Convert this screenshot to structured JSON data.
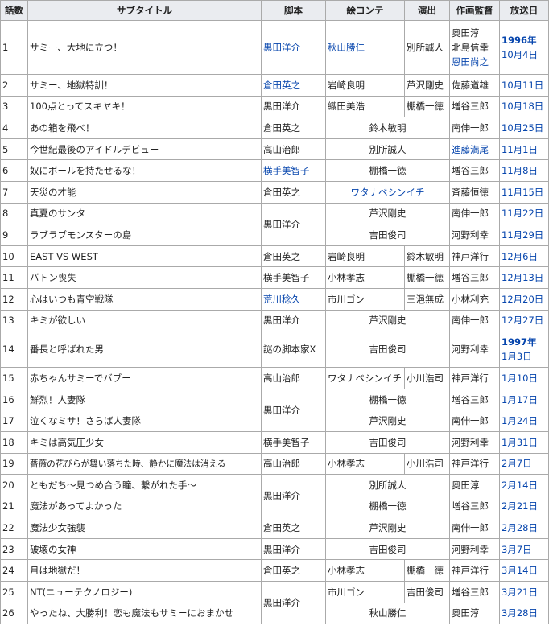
{
  "headers": {
    "num": "話数",
    "subtitle": "サブタイトル",
    "script": "脚本",
    "storyboard": "絵コンテ",
    "director": "演出",
    "animation": "作画監督",
    "airdate": "放送日"
  },
  "episodes": [
    {
      "num": "1",
      "subtitle": "サミー、大地に立つ！",
      "script": "黒田洋介",
      "storyboard": "秋山勝仁",
      "director": "別所誠人",
      "animation": [
        "奥田淳",
        "北島信幸",
        "恩田尚之"
      ],
      "year": "1996年",
      "date": "10月4日"
    },
    {
      "num": "2",
      "subtitle": "サミー、地獄特訓！",
      "script": "倉田英之",
      "storyboard": "岩崎良明",
      "director": "芦沢剛史",
      "animation": [
        "佐藤道雄"
      ],
      "date": "10月11日"
    },
    {
      "num": "3",
      "subtitle": "100点とってスキヤキ！",
      "script": "黒田洋介",
      "storyboard": "織田美浩",
      "director": "棚橋一徳",
      "animation": [
        "増谷三郎"
      ],
      "date": "10月18日"
    },
    {
      "num": "4",
      "subtitle": "あの箱を飛べ！",
      "script": "倉田英之",
      "storyboard": "鈴木敏明",
      "animation": [
        "南伸一郎"
      ],
      "date": "10月25日"
    },
    {
      "num": "5",
      "subtitle": "今世紀最後のアイドルデビュー",
      "script": "高山治郎",
      "storyboard": "別所誠人",
      "animation": [
        "進藤満尾"
      ],
      "date": "11月1日"
    },
    {
      "num": "6",
      "subtitle": "奴にボールを持たせるな！",
      "script": "横手美智子",
      "storyboard": "棚橋一徳",
      "animation": [
        "増谷三郎"
      ],
      "date": "11月8日"
    },
    {
      "num": "7",
      "subtitle": "天災の才能",
      "script": "倉田英之",
      "storyboard": "ワタナベシンイチ",
      "animation": [
        "斉藤恒徳"
      ],
      "date": "11月15日"
    },
    {
      "num": "8",
      "subtitle": "真夏のサンタ",
      "script": "黒田洋介",
      "storyboard": "芦沢剛史",
      "animation": [
        "南伸一郎"
      ],
      "date": "11月22日"
    },
    {
      "num": "9",
      "subtitle": "ラブラブモンスターの島",
      "storyboard": "吉田俊司",
      "animation": [
        "河野利幸"
      ],
      "date": "11月29日"
    },
    {
      "num": "10",
      "subtitle": "EAST VS WEST",
      "script": "倉田英之",
      "storyboard": "岩崎良明",
      "director": "鈴木敏明",
      "animation": [
        "神戸洋行"
      ],
      "date": "12月6日"
    },
    {
      "num": "11",
      "subtitle": "バトン喪失",
      "script": "横手美智子",
      "storyboard": "小林孝志",
      "director": "棚橋一徳",
      "animation": [
        "増谷三郎"
      ],
      "date": "12月13日"
    },
    {
      "num": "12",
      "subtitle": "心はいつも青空戦隊",
      "script": "荒川稔久",
      "storyboard": "市川ゴン",
      "director": "三浥無成",
      "animation": [
        "小林利充"
      ],
      "date": "12月20日"
    },
    {
      "num": "13",
      "subtitle": "キミが欲しい",
      "script": "黒田洋介",
      "storyboard": "芦沢剛史",
      "animation": [
        "南伸一郎"
      ],
      "date": "12月27日"
    },
    {
      "num": "14",
      "subtitle": "番長と呼ばれた男",
      "script": "謎の脚本家X",
      "storyboard": "吉田俊司",
      "animation": [
        "河野利幸"
      ],
      "year": "1997年",
      "date": "1月3日"
    },
    {
      "num": "15",
      "subtitle": "赤ちゃんサミーでバブー",
      "script": "高山治郎",
      "storyboard": "ワタナベシンイチ",
      "director": "小川浩司",
      "animation": [
        "神戸洋行"
      ],
      "date": "1月10日"
    },
    {
      "num": "16",
      "subtitle": "鮮烈！人妻隊",
      "script": "黒田洋介",
      "storyboard": "棚橋一徳",
      "animation": [
        "増谷三郎"
      ],
      "date": "1月17日"
    },
    {
      "num": "17",
      "subtitle": "泣くなミサ！さらば人妻隊",
      "storyboard": "芦沢剛史",
      "animation": [
        "南伸一郎"
      ],
      "date": "1月24日"
    },
    {
      "num": "18",
      "subtitle": "キミは高気圧少女",
      "script": "横手美智子",
      "storyboard": "吉田俊司",
      "animation": [
        "河野利幸"
      ],
      "date": "1月31日"
    },
    {
      "num": "19",
      "subtitle": "薔薇の花びらが舞い落ちた時、静かに魔法は消える",
      "script": "高山治郎",
      "storyboard": "小林孝志",
      "director": "小川浩司",
      "animation": [
        "神戸洋行"
      ],
      "date": "2月7日"
    },
    {
      "num": "20",
      "subtitle": "ともだち〜見つめ合う瞳、繋がれた手〜",
      "script": "黒田洋介",
      "storyboard": "別所誠人",
      "animation": [
        "奥田淳"
      ],
      "date": "2月14日"
    },
    {
      "num": "21",
      "subtitle": "魔法があってよかった",
      "storyboard": "棚橋一徳",
      "animation": [
        "増谷三郎"
      ],
      "date": "2月21日"
    },
    {
      "num": "22",
      "subtitle": "魔法少女強襲",
      "script": "倉田英之",
      "storyboard": "芦沢剛史",
      "animation": [
        "南伸一郎"
      ],
      "date": "2月28日"
    },
    {
      "num": "23",
      "subtitle": "破壊の女神",
      "script": "黒田洋介",
      "storyboard": "吉田俊司",
      "animation": [
        "河野利幸"
      ],
      "date": "3月7日"
    },
    {
      "num": "24",
      "subtitle": "月は地獄だ！",
      "script": "倉田英之",
      "storyboard": "小林孝志",
      "director": "棚橋一徳",
      "animation": [
        "神戸洋行"
      ],
      "date": "3月14日"
    },
    {
      "num": "25",
      "subtitle": "NT(ニューテクノロジー)",
      "script": "黒田洋介",
      "storyboard": "市川ゴン",
      "director": "吉田俊司",
      "animation": [
        "増谷三郎"
      ],
      "date": "3月21日"
    },
    {
      "num": "26",
      "subtitle": "やったね、大勝利！恋も魔法もサミーにおまかせ",
      "storyboard": "秋山勝仁",
      "animation": [
        "奥田淳"
      ],
      "date": "3月28日"
    }
  ],
  "colors": {
    "header_bg": "#eaecf0",
    "border": "#aaaaaa",
    "link": "#0645ad",
    "text": "#222222"
  }
}
